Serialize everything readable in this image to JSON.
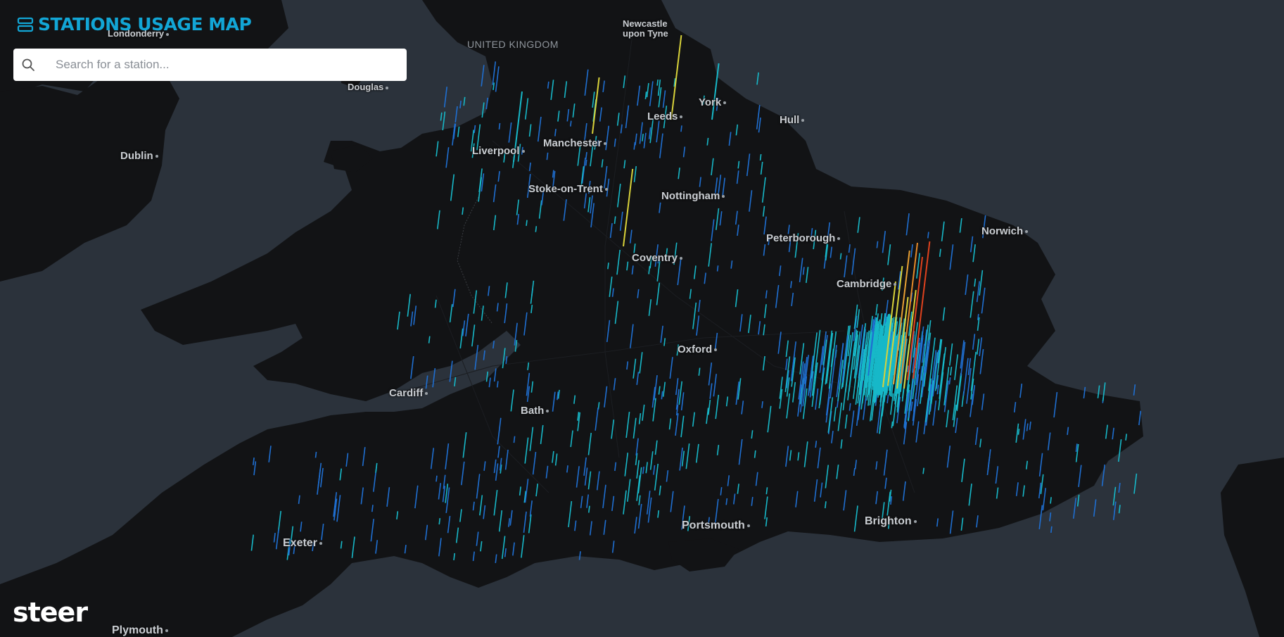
{
  "app": {
    "title": "STATIONS USAGE MAP",
    "logo_text": "steer",
    "accent_color": "#12a6d6"
  },
  "search": {
    "placeholder": "Search for a station...",
    "value": "",
    "icon": "search-icon"
  },
  "map": {
    "country_label": "UNITED KINGDOM",
    "cities": [
      {
        "name": "Londonderry",
        "size": "small"
      },
      {
        "name": "Newcastle\nupon Tyne",
        "size": "small"
      },
      {
        "name": "Douglas",
        "size": "small"
      },
      {
        "name": "York",
        "size": "normal"
      },
      {
        "name": "Leeds",
        "size": "normal"
      },
      {
        "name": "Hull",
        "size": "normal"
      },
      {
        "name": "Dublin",
        "size": "normal"
      },
      {
        "name": "Liverpool",
        "size": "normal"
      },
      {
        "name": "Manchester",
        "size": "normal"
      },
      {
        "name": "Stoke-on-Trent",
        "size": "normal"
      },
      {
        "name": "Nottingham",
        "size": "normal"
      },
      {
        "name": "Peterborough",
        "size": "normal"
      },
      {
        "name": "Norwich",
        "size": "normal"
      },
      {
        "name": "Coventry",
        "size": "normal"
      },
      {
        "name": "Cambridge",
        "size": "normal"
      },
      {
        "name": "Oxford",
        "size": "normal"
      },
      {
        "name": "Cardiff",
        "size": "normal"
      },
      {
        "name": "Bath",
        "size": "normal"
      },
      {
        "name": "Portsmouth",
        "size": "large"
      },
      {
        "name": "Brighton",
        "size": "large"
      },
      {
        "name": "Exeter",
        "size": "large"
      },
      {
        "name": "Plymouth",
        "size": "large"
      }
    ],
    "colors": {
      "water": "#2b323b",
      "land": "#121315",
      "low": "#1f6fd1",
      "mid": "#17b8c8",
      "high": "#d8d23a",
      "peak": "#e0421e"
    }
  }
}
